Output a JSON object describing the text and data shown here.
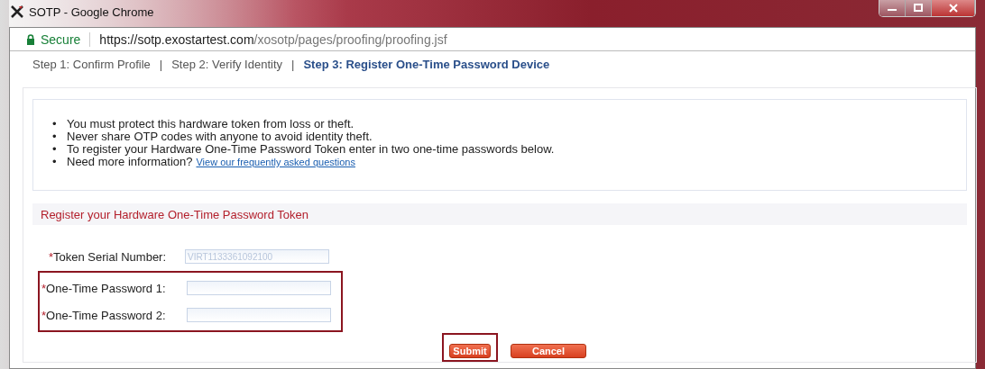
{
  "window": {
    "title": "SOTP - Google Chrome"
  },
  "address_bar": {
    "security": "Secure",
    "url_host": "https://sotp.exostartest.com",
    "url_path": "/xosotp/pages/proofing/proofing.jsf"
  },
  "steps": [
    {
      "label": "Step 1: Confirm Profile",
      "selected": false
    },
    {
      "label": "Step 2: Verify Identity",
      "selected": false
    },
    {
      "label": "Step 3: Register One-Time Password Device",
      "selected": true
    }
  ],
  "separator": "|",
  "bullet": "•",
  "notes": [
    "You must protect this hardware token from loss or theft.",
    "Never share OTP codes with anyone to avoid identity theft.",
    "To register your Hardware One-Time Password Token enter in two one-time passwords below."
  ],
  "more_info": {
    "text": "Need more information?",
    "link": "View our frequently asked questions"
  },
  "section_title": "Register your Hardware One-Time Password Token",
  "fields": [
    {
      "required_mark": "*",
      "label": "Token Serial Number:",
      "value": "VIRT1133361092100"
    }
  ],
  "highlighted_fields": [
    {
      "required_mark": "*",
      "label": "One-Time Password 1:"
    },
    {
      "required_mark": "*",
      "label": "One-Time Password 2:"
    }
  ],
  "highlighted_buttons": [
    "Submit"
  ],
  "buttons": [
    "Cancel"
  ]
}
